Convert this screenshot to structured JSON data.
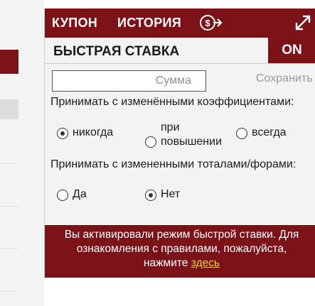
{
  "header": {
    "tab_coupon": "КУПОН",
    "tab_history": "ИСТОРИЯ",
    "icons": {
      "coupon": "coupon-exchange-icon",
      "expand": "expand-arrows-icon"
    }
  },
  "quick_bet": {
    "title": "БЫСТРАЯ СТАВКА",
    "toggle_label": "ON"
  },
  "amount": {
    "placeholder": "Сумма",
    "value": ""
  },
  "save_label": "Сохранить",
  "odds_change": {
    "question": "Принимать с изменёнными коэффициентами:",
    "options": [
      {
        "label": "никогда",
        "selected": true
      },
      {
        "label": "при повышении",
        "selected": false
      },
      {
        "label": "всегда",
        "selected": false
      }
    ]
  },
  "totals_change": {
    "question": "Принимать с измененными тоталами/форами:",
    "options": [
      {
        "label": "Да",
        "selected": false
      },
      {
        "label": "Нет",
        "selected": true
      }
    ]
  },
  "notice": {
    "text": "Вы активировали режим быстрой ставки. Для ознакомления с правилами, пожалуйста, нажмите",
    "link": "здесь"
  },
  "colors": {
    "brand": "#7a1218",
    "link": "#f2c84b",
    "panel_bg": "#f3f3f3"
  }
}
